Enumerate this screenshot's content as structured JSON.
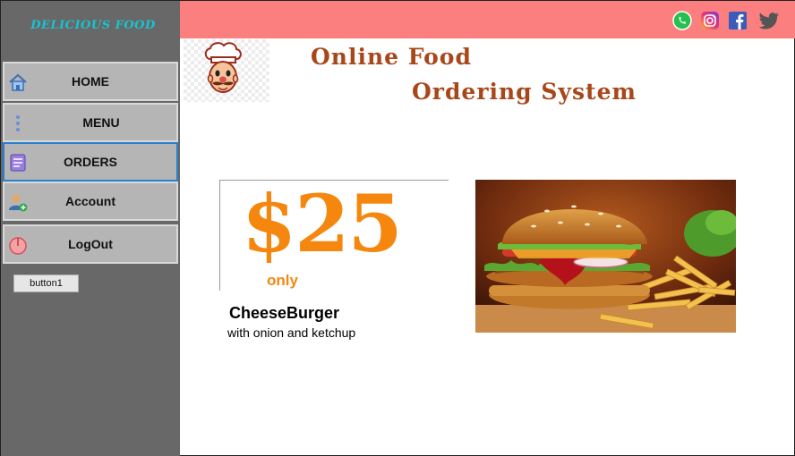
{
  "sidebar": {
    "brand": "DELICIOUS FOOD",
    "items": [
      {
        "label": "HOME",
        "icon": "home-icon"
      },
      {
        "label": "MENU",
        "icon": "menu-dots-icon"
      },
      {
        "label": "ORDERS",
        "icon": "orders-icon",
        "active": true
      },
      {
        "label": "Account",
        "icon": "add-user-icon"
      },
      {
        "label": "LogOut",
        "icon": "power-icon"
      }
    ],
    "button1": "button1"
  },
  "topbar": {
    "background": "#fc7f7f",
    "social_icons": [
      "whatsapp-icon",
      "instagram-icon",
      "facebook-icon",
      "twitter-icon"
    ]
  },
  "header": {
    "title_line1": "Online Food",
    "title_line2": "Ordering System",
    "logo": "chef-logo"
  },
  "promo": {
    "price": "$25",
    "price_note": "only",
    "item_name": "CheeseBurger",
    "item_description": "with onion and ketchup",
    "accent": "#f5870f"
  }
}
